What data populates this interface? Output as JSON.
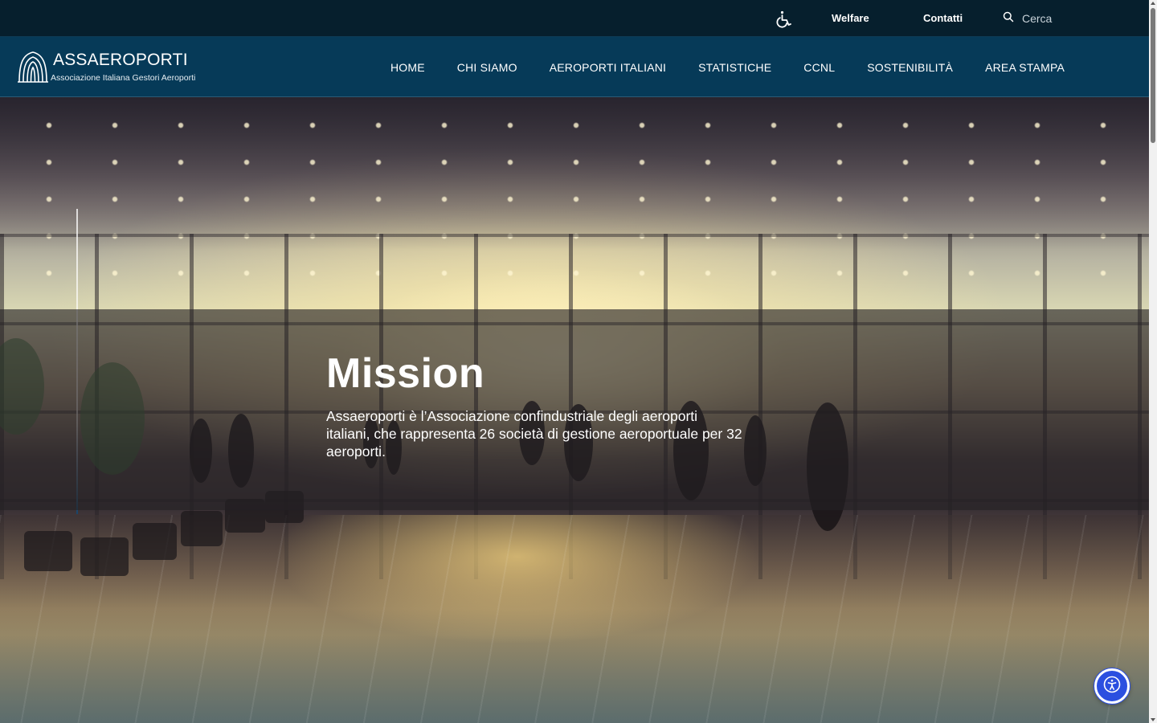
{
  "topbar": {
    "accessibility_icon": "wheelchair-icon",
    "welfare_label": "Welfare",
    "contatti_label": "Contatti",
    "search": {
      "icon": "search-icon",
      "placeholder": "Cerca"
    }
  },
  "brand": {
    "name": "ASSAEROPORTI",
    "tagline": "Associazione Italiana Gestori Aeroporti",
    "mark_icon": "assaeroporti-logo-icon"
  },
  "nav": {
    "items": [
      {
        "label": "HOME"
      },
      {
        "label": "CHI SIAMO"
      },
      {
        "label": "AEROPORTI ITALIANI"
      },
      {
        "label": "STATISTICHE"
      },
      {
        "label": "CCNL"
      },
      {
        "label": "SOSTENIBILITÀ"
      },
      {
        "label": "AREA STAMPA"
      }
    ]
  },
  "hero": {
    "title": "Mission",
    "text": "Assaeroporti è l’Associazione confindustriale degli aeroporti italiani, che rappresenta 26 società di gestione aeroportuale per 32 aeroporti.",
    "background": "airport-terminal-sunset-photo"
  },
  "floating": {
    "accessibility_button_icon": "accessibility-person-icon"
  },
  "colors": {
    "topbar_bg": "#061f2d",
    "navbar_bg": "#063a58",
    "fab_bg": "#2b4fe0",
    "text": "#ffffff"
  }
}
